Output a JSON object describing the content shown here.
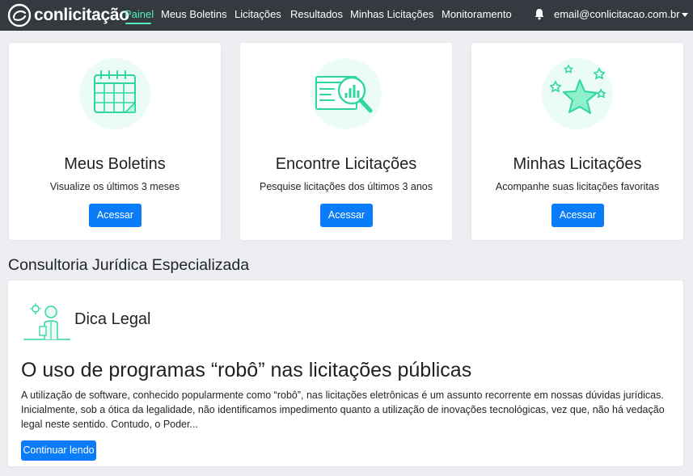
{
  "navbar": {
    "brand": "conlicitação",
    "links": [
      "Painel",
      "Meus Boletins",
      "Licitações",
      "Resultados",
      "Minhas Licitações",
      "Monitoramento"
    ],
    "email": "email@conlicitacao.com.br",
    "icons": [
      "logo-icon",
      "bell-icon",
      "caret-down-icon"
    ]
  },
  "cards": [
    {
      "title": "Meus Boletins",
      "subtitle": "Visualize os últimos 3 meses",
      "button": "Acessar",
      "icon": "calendar-icon"
    },
    {
      "title": "Encontre Licitações",
      "subtitle": "Pesquise licitações dos últimos 3 anos",
      "button": "Acessar",
      "icon": "search-chart-icon"
    },
    {
      "title": "Minhas Licitações",
      "subtitle": "Acompanhe suas licitações favoritas",
      "button": "Acessar",
      "icon": "star-icon"
    }
  ],
  "section": {
    "title": "Consultoria Jurídica Especializada"
  },
  "article": {
    "label": "Dica Legal",
    "title": "O uso de programas “robô” nas licitações públicas",
    "body": "A utilização de software, conhecido popularmente como “robô”, nas licitações eletrônicas é um assunto recorrente em nossas dúvidas jurídicas. Inicialmente, sob a ótica da legalidade, não identificamos impedimento quanto a utilização de inovações tecnológicas, vez que, não há vedação legal neste sentido. Contudo, o Poder...",
    "button": "Continuar lendo",
    "icon": "lawyer-icon"
  },
  "colors": {
    "navbar": "#343a40",
    "accent": "#54f0b8",
    "primary": "#0b7cf8",
    "background": "#eceef1"
  }
}
